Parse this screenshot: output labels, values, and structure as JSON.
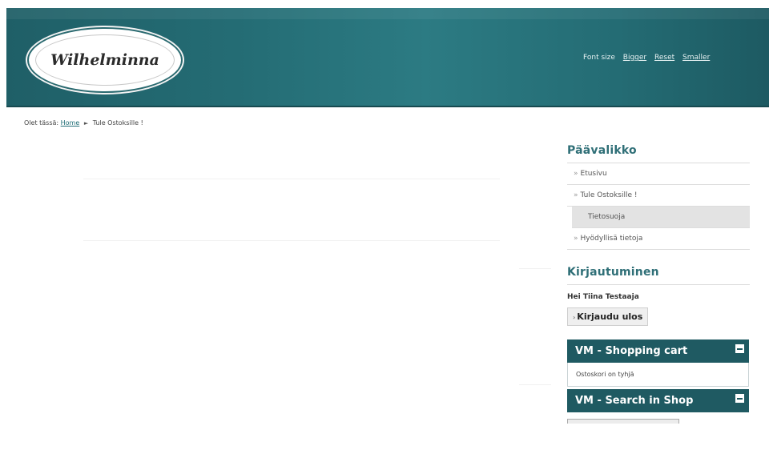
{
  "header": {
    "logo_text": "Wilhelminna",
    "font_size_label": "Font size",
    "bigger": "Bigger",
    "reset": "Reset",
    "smaller": "Smaller"
  },
  "breadcrumb": {
    "prefix": "Olet tässä:",
    "home": "Home",
    "current": "Tule Ostoksille !"
  },
  "main_menu": {
    "title": "Päävalikko",
    "items": [
      {
        "label": "Etusivu"
      },
      {
        "label": "Tule Ostoksille !"
      },
      {
        "label": "Tietosuoja"
      },
      {
        "label": "Hyödyllisä tietoja"
      }
    ]
  },
  "login": {
    "title": "Kirjautuminen",
    "greeting": "Hei Tiina Testaaja",
    "logout_label": "Kirjaudu ulos"
  },
  "cart": {
    "title": "VM - Shopping cart",
    "empty_text": "Ostoskori on tyhjä"
  },
  "search": {
    "title": "VM - Search in Shop"
  },
  "colors": {
    "header": "#246c74",
    "accent": "#2f6f77",
    "module_header": "#1f5a62"
  }
}
